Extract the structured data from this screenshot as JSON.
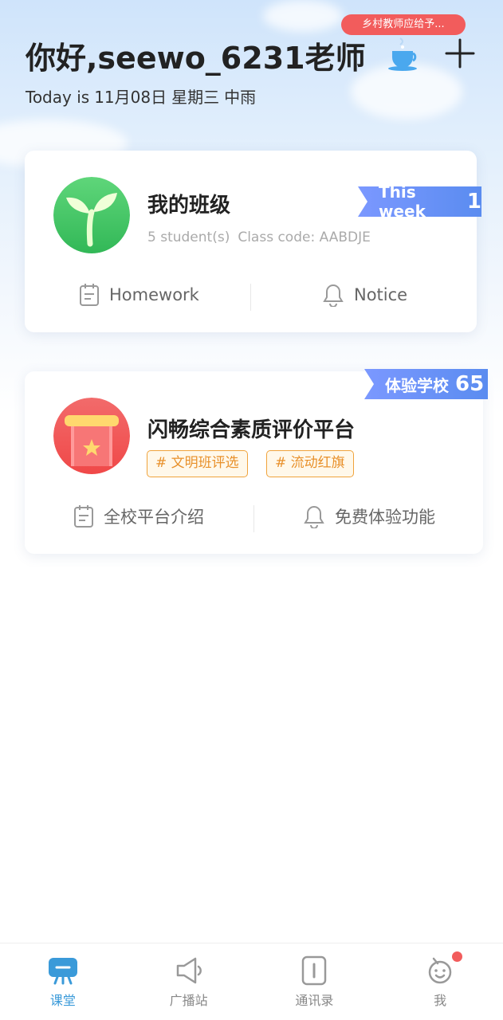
{
  "header": {
    "promo_banner": "乡村教师应给予...",
    "greeting": "你好,seewo_6231老师",
    "date_prefix": "Today is",
    "date": "11月08日",
    "weekday": "星期三",
    "weather": "中雨",
    "icons": [
      "teacup-icon",
      "plus-icon"
    ]
  },
  "class_card": {
    "title": "我的班级",
    "students": "5 student(s)",
    "class_code": "Class code: AABDJE",
    "ribbon_label": "This week",
    "ribbon_count": "1",
    "actions": [
      {
        "label": "Homework",
        "icon": "clipboard-icon"
      },
      {
        "label": "Notice",
        "icon": "bell-icon"
      }
    ]
  },
  "platform_card": {
    "title": "闪畅综合素质评价平台",
    "ribbon_label": "体验学校",
    "ribbon_count": "65",
    "tags": [
      "# 文明班评选",
      "# 流动红旗"
    ],
    "actions": [
      {
        "label": "全校平台介绍",
        "icon": "clipboard-icon"
      },
      {
        "label": "免费体验功能",
        "icon": "bell-icon"
      }
    ]
  },
  "tabbar": {
    "items": [
      {
        "label": "课堂",
        "icon": "classroom-icon",
        "active": true
      },
      {
        "label": "广播站",
        "icon": "speaker-icon",
        "active": false
      },
      {
        "label": "通讯录",
        "icon": "contacts-icon",
        "active": false
      },
      {
        "label": "我",
        "icon": "profile-icon",
        "active": false,
        "badge": true
      }
    ]
  },
  "colors": {
    "accent": "#3a9ad9",
    "ribbon": "#6b92f5",
    "promo": "#f25c5c",
    "tag": "#e8902a",
    "class_avatar": "#4cc96a",
    "platform_avatar": "#f25c5c"
  }
}
